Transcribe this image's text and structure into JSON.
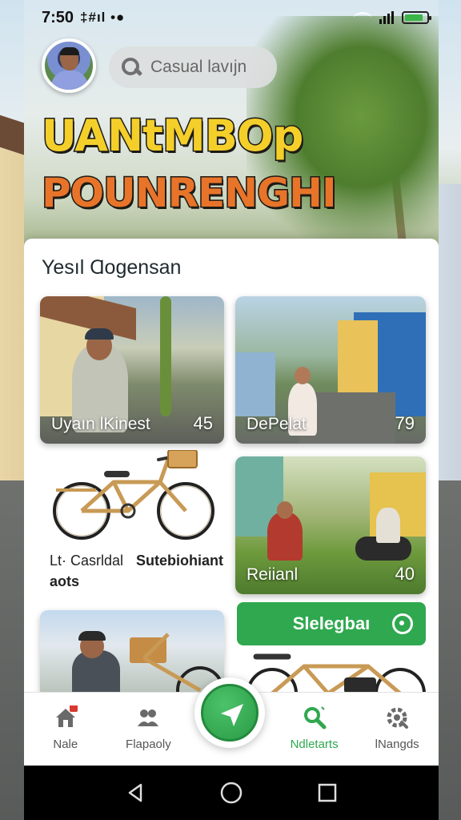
{
  "status_bar": {
    "time": "7:50",
    "indicators": "‡#ıl •●",
    "battery_level": 0.85,
    "accent": "#3bb54a"
  },
  "header": {
    "search_placeholder": "Casual lavıjn",
    "headline_line1": "UANtMBOp",
    "headline_line2": "POUNRENGHI",
    "headline_colors": [
      "#f4cf2a",
      "#e8742a"
    ]
  },
  "section": {
    "title": "Yesıl Ɑogensan"
  },
  "tiles": [
    {
      "label": "Uyaın lKinest",
      "count": "45"
    },
    {
      "label": "DePelat",
      "count": "79"
    },
    {
      "caption_line1a": "Lt· Casrldal",
      "caption_line1b": "Sutebiohiant",
      "caption_line2": "aots"
    },
    {
      "label": "Reiianl",
      "count": "40"
    },
    {
      "label": ""
    }
  ],
  "action_button": {
    "label": "Slelegbaı",
    "color": "#2fa84f"
  },
  "bottom_nav": [
    {
      "label": "Nale",
      "icon": "home-icon",
      "active": false
    },
    {
      "label": "Flapaoly",
      "icon": "people-icon",
      "active": false
    },
    {
      "label": "",
      "icon": "navigate-icon",
      "active": false
    },
    {
      "label": "Ndletarts",
      "icon": "search-icon",
      "active": true
    },
    {
      "label": "lNangds",
      "icon": "settings-icon",
      "active": false
    }
  ]
}
